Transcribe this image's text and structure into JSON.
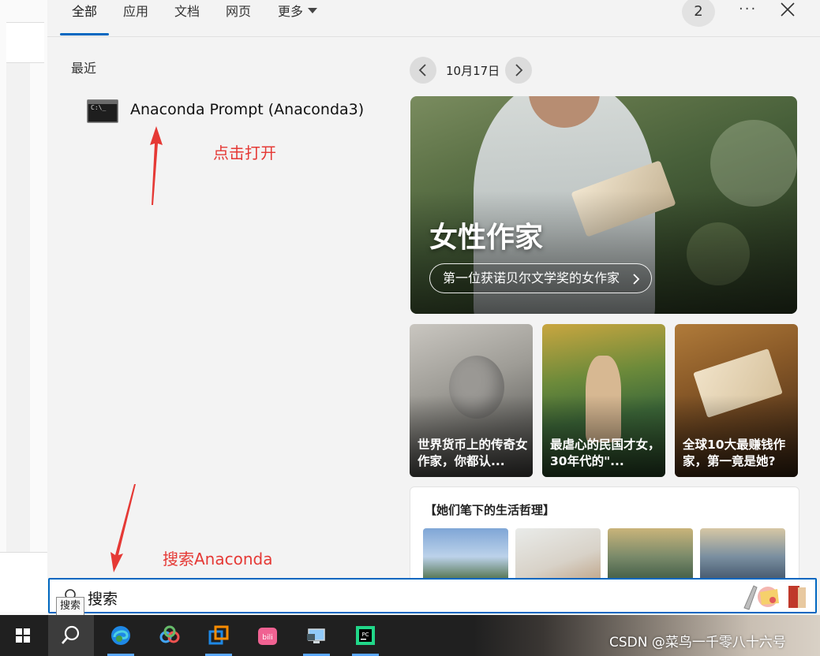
{
  "tabs": [
    {
      "label": "全部",
      "active": true
    },
    {
      "label": "应用"
    },
    {
      "label": "文档"
    },
    {
      "label": "网页"
    },
    {
      "label": "更多"
    }
  ],
  "header": {
    "badge_count": "2",
    "more_label": "···"
  },
  "recent": {
    "title": "最近",
    "items": [
      {
        "label": "Anaconda Prompt (Anaconda3)",
        "icon": "terminal-icon"
      }
    ]
  },
  "annotations": {
    "click_open": "点击打开",
    "search_hint": "搜索Anaconda",
    "color": "#e53935"
  },
  "date_nav": {
    "date": "10月17日"
  },
  "hero": {
    "title": "女性作家",
    "subtitle": "第一位获诺贝尔文学奖的女作家"
  },
  "cards": [
    {
      "title": "世界货币上的传奇女作家，你都认..."
    },
    {
      "title": "最虐心的民国才女，30年代的\"..."
    },
    {
      "title": "全球10大最赚钱作家，第一竟是她?"
    }
  ],
  "wisdom": {
    "title": "【她们笔下的生活哲理】"
  },
  "search": {
    "value": "搜索",
    "tooltip": "搜索"
  },
  "taskbar": {
    "items": [
      "windows-start-icon",
      "search-icon",
      "edge-icon",
      "baidu-netdisk-icon",
      "vmware-icon",
      "bilibili-icon",
      "remote-desktop-icon",
      "pycharm-icon"
    ],
    "watermark": "CSDN @菜鸟一千零八十六号"
  },
  "colors": {
    "accent": "#0067c0"
  }
}
